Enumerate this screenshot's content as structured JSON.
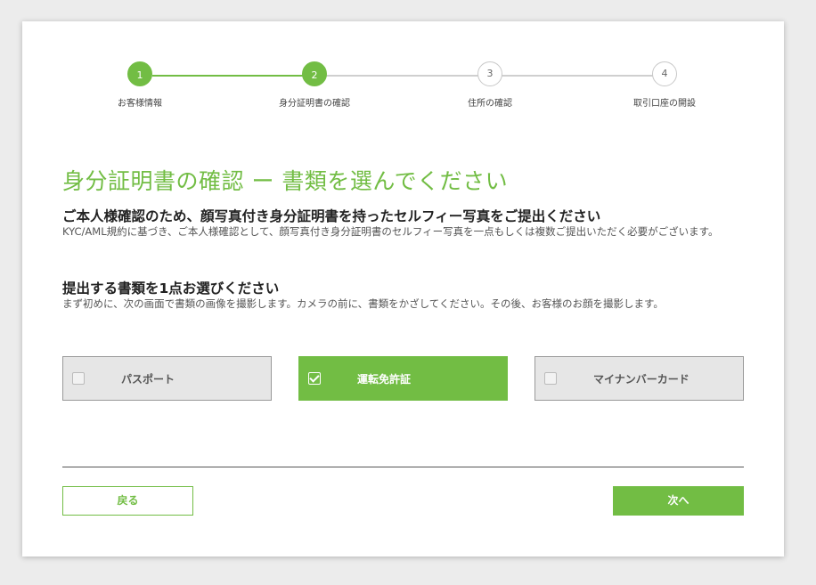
{
  "stepper": {
    "steps": [
      {
        "number": "1",
        "label": "お客様情報",
        "state": "done"
      },
      {
        "number": "2",
        "label": "身分証明書の確認",
        "state": "current"
      },
      {
        "number": "3",
        "label": "住所の確認",
        "state": "todo"
      },
      {
        "number": "4",
        "label": "取引口座の開設",
        "state": "todo"
      }
    ]
  },
  "main": {
    "title": "身分証明書の確認 ー 書類を選んでください",
    "section1": {
      "heading": "ご本人様確認のため、顔写真付き身分証明書を持ったセルフィー写真をご提出ください",
      "text": "KYC/AML規約に基づき、ご本人様確認として、顔写真付き身分証明書のセルフィー写真を一点もしくは複数ご提出いただく必要がございます。"
    },
    "section2": {
      "heading": "提出する書類を1点お選びください",
      "text": "まず初めに、次の画面で書類の画像を撮影します。カメラの前に、書類をかざしてください。その後、お客様のお顔を撮影します。"
    },
    "options": [
      {
        "label": "パスポート",
        "checked": false
      },
      {
        "label": "運転免許証",
        "checked": true
      },
      {
        "label": "マイナンバーカード",
        "checked": false
      }
    ]
  },
  "footer": {
    "back_label": "戻る",
    "next_label": "次へ"
  },
  "colors": {
    "accent": "#72bd44",
    "inactive_option_bg": "#e6e6e6",
    "page_bg": "#ececec"
  }
}
